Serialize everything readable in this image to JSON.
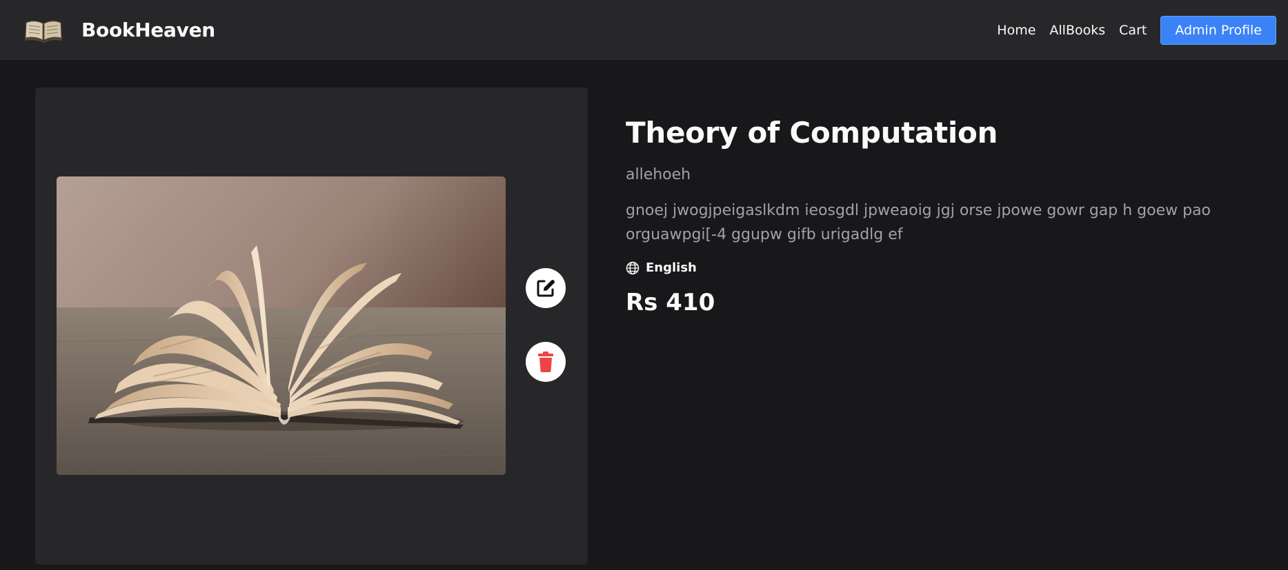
{
  "brand": {
    "name": "BookHeaven",
    "logo_icon": "open-book-logo-icon"
  },
  "nav": {
    "links": [
      "Home",
      "AllBooks",
      "Cart"
    ],
    "profile_button": "Admin Profile"
  },
  "book": {
    "title": "Theory of Computation",
    "author": "allehoeh",
    "description": "gnoej jwogjpeigaslkdm ieosgdl jpweaoig jgj orse jpowe gowr gap h goew pao orguawpgi[-4 ggupw gifb urigadlg ef",
    "language": "English",
    "price": "Rs 410"
  },
  "actions": {
    "edit_icon": "edit-icon",
    "delete_icon": "trash-icon"
  },
  "colors": {
    "background": "#18181b",
    "panel": "#27272a",
    "accent": "#3b82f6",
    "delete": "#ef4444",
    "muted_text": "#a1a1aa"
  }
}
